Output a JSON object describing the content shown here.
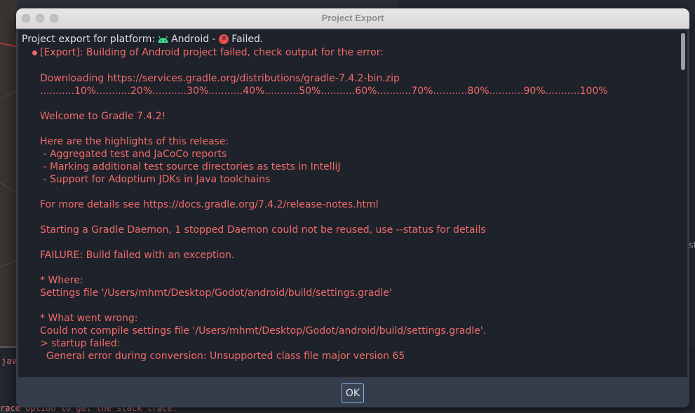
{
  "background": {
    "right_fragment": "st",
    "java_fragment": "jav",
    "console_fragment": "race option to get the stack trace."
  },
  "dialog": {
    "title": "Project Export",
    "header": {
      "prefix": "Project export for platform:",
      "platform": "Android",
      "separator": "-",
      "status": "Failed.",
      "platform_icon": "android-icon",
      "status_icon": "error-circle-icon"
    },
    "error_line": "[Export]: Building of Android project failed, check output for the error:",
    "output_lines": [
      "Downloading https://services.gradle.org/distributions/gradle-7.4.2-bin.zip",
      "...........10%...........20%...........30%...........40%...........50%...........60%...........70%...........80%...........90%...........100%",
      "",
      "Welcome to Gradle 7.4.2!",
      "",
      "Here are the highlights of this release:",
      " - Aggregated test and JaCoCo reports",
      " - Marking additional test source directories as tests in IntelliJ",
      " - Support for Adoptium JDKs in Java toolchains",
      "",
      "For more details see https://docs.gradle.org/7.4.2/release-notes.html",
      "",
      "Starting a Gradle Daemon, 1 stopped Daemon could not be reused, use --status for details",
      "",
      "FAILURE: Build failed with an exception.",
      "",
      "* Where:",
      "Settings file '/Users/mhmt/Desktop/Godot/android/build/settings.gradle'",
      "",
      "* What went wrong:",
      "Could not compile settings file '/Users/mhmt/Desktop/Godot/android/build/settings.gradle'.",
      "> startup failed:",
      "  General error during conversion: Unsupported class file major version 65"
    ],
    "ok_label": "OK"
  },
  "colors": {
    "error_text": "#f06b6b",
    "log_background": "#1e222a",
    "dialog_background": "#363d4a",
    "focus_border": "#7fb3f0",
    "android_green": "#3ddc84"
  }
}
